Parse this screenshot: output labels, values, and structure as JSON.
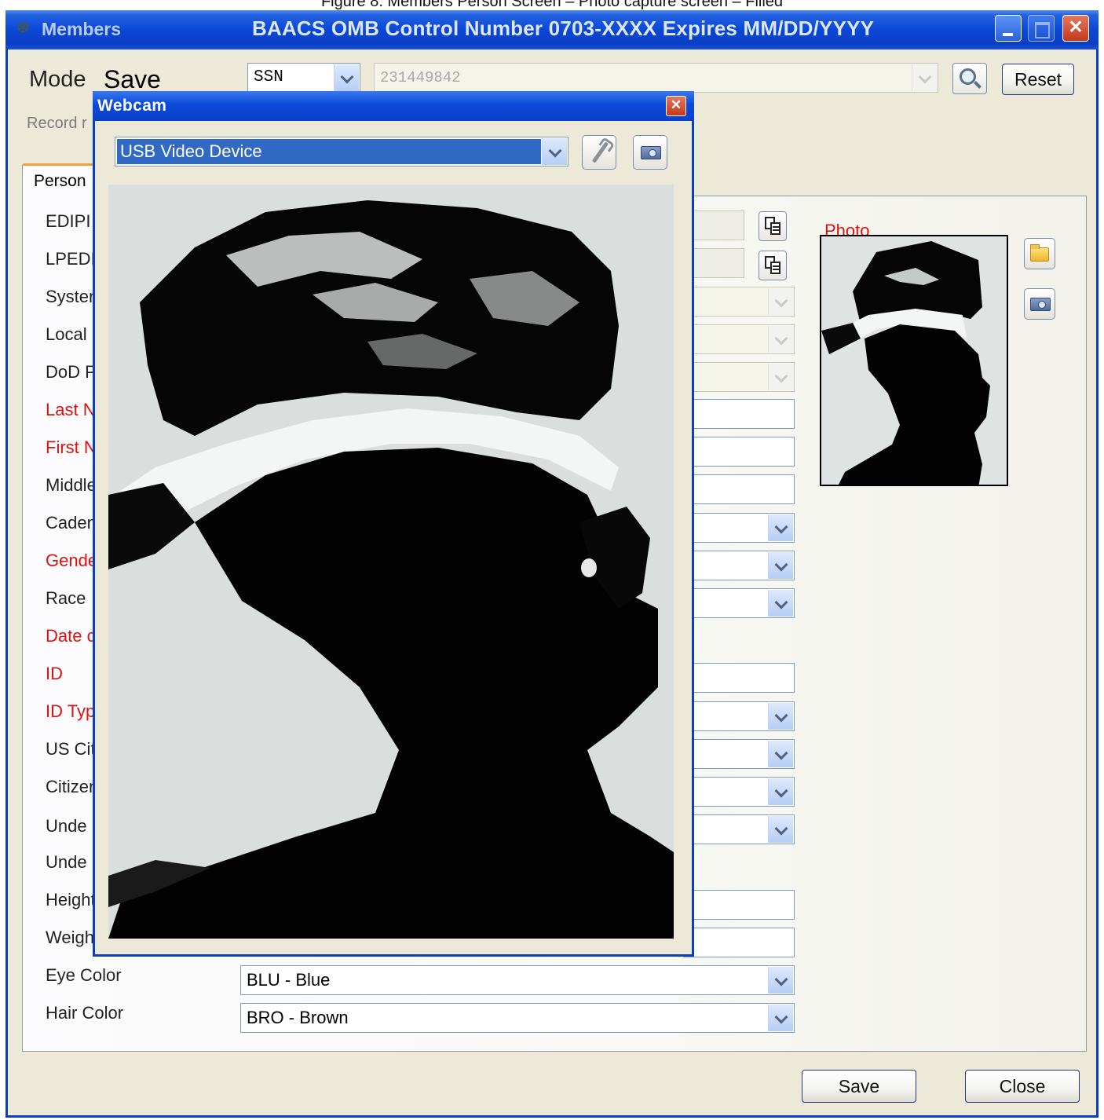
{
  "caption": "Figure 8. Members Person Screen – Photo capture screen – Filled",
  "window": {
    "app_name": "Members",
    "title": "BAACS OMB Control Number 0703-XXXX Expires MM/DD/YYYY",
    "icon": "bat-icon"
  },
  "toolbar": {
    "mode_label": "Mode",
    "mode_value": "Save",
    "search_type": "SSN",
    "search_value": "231449842",
    "reset_label": "Reset",
    "search_icon": "magnifier-icon"
  },
  "record_label": "Record r",
  "tabs": {
    "active": "Person"
  },
  "form": {
    "rows": [
      {
        "label": "EDIPI",
        "required": false
      },
      {
        "label": "LPEDI",
        "required": false
      },
      {
        "label": "Systen",
        "required": false
      },
      {
        "label": "Local I",
        "required": false
      },
      {
        "label": "DoD P",
        "required": false
      },
      {
        "label": "Last N",
        "required": true
      },
      {
        "label": "First N",
        "required": true
      },
      {
        "label": "Middle",
        "required": false
      },
      {
        "label": "Caden",
        "required": false
      },
      {
        "label": "Gende",
        "required": true
      },
      {
        "label": "Race",
        "required": false
      },
      {
        "label": "Date c",
        "required": true
      },
      {
        "label": "ID",
        "required": true
      },
      {
        "label": "ID Typ",
        "required": true
      },
      {
        "label": "US Cit",
        "required": false
      },
      {
        "label": "Citizen",
        "required": false
      },
      {
        "label": "Unde",
        "required": false
      },
      {
        "label": "Unde",
        "required": false
      },
      {
        "label": "Height",
        "required": false
      },
      {
        "label": "Weigh",
        "required": false
      },
      {
        "label": "Eye Color",
        "required": false
      },
      {
        "label": "Hair Color",
        "required": false
      }
    ],
    "eye_color_value": "BLU - Blue",
    "hair_color_value": "BRO - Brown"
  },
  "photo": {
    "label": "Photo"
  },
  "footer": {
    "save_label": "Save",
    "close_label": "Close"
  },
  "webcam": {
    "title": "Webcam",
    "device": "USB Video Device",
    "settings_icon": "wrench-icon",
    "capture_icon": "camera-icon"
  }
}
